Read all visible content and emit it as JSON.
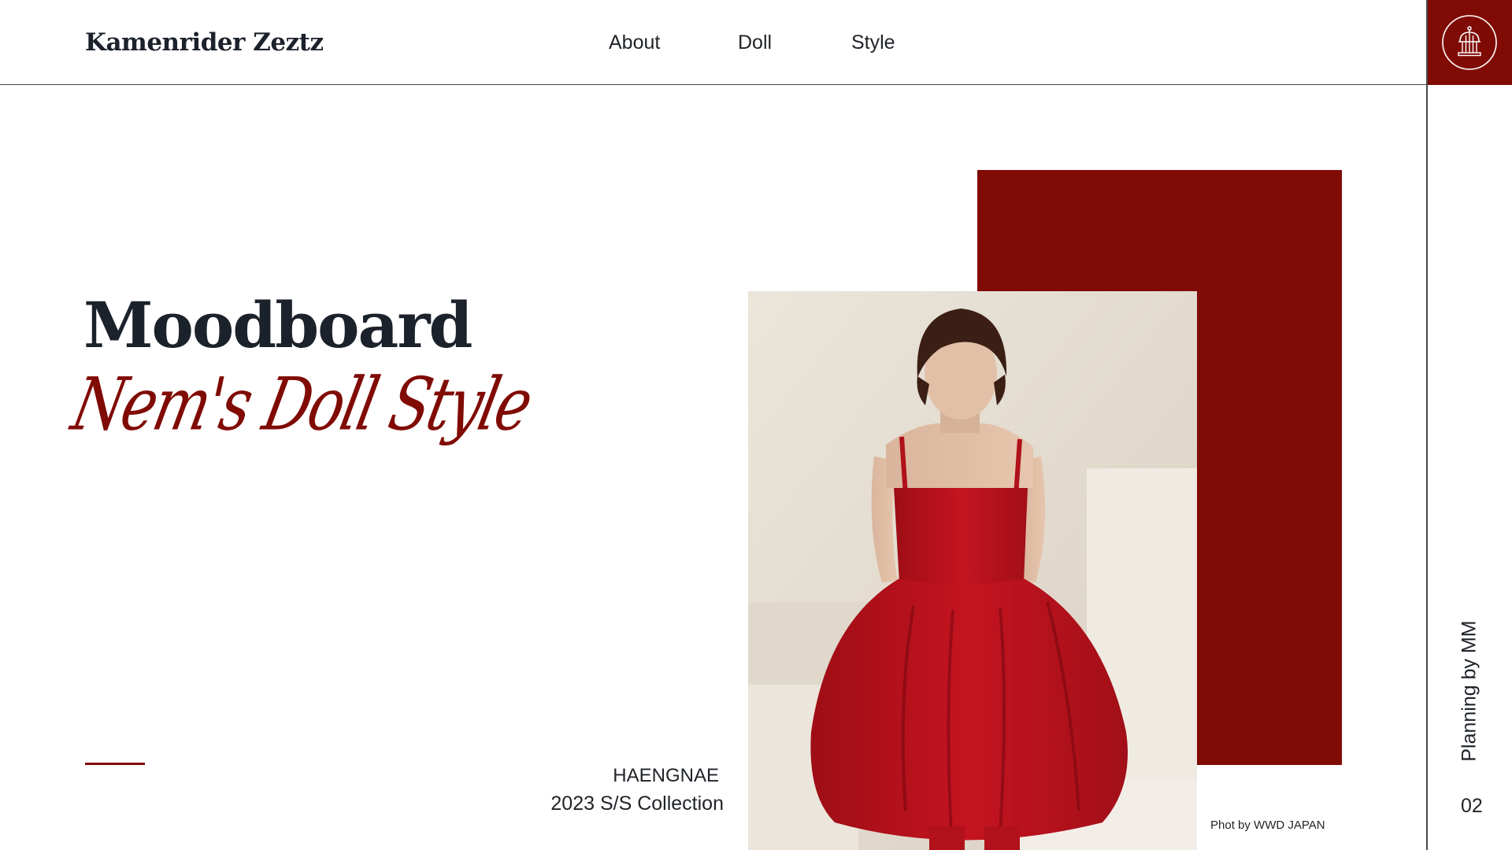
{
  "header": {
    "brand": "Kamenrider Zeztz",
    "nav": [
      {
        "label": "About"
      },
      {
        "label": "Doll"
      },
      {
        "label": "Style"
      }
    ],
    "logo_icon": "birdcage-icon"
  },
  "hero": {
    "title": "Moodboard",
    "script_subtitle": "Nem's Doll Style"
  },
  "collection": {
    "brand": "HAENGNAE",
    "season": "2023 S/S Collection"
  },
  "photo": {
    "credit": "Phot by WWD JAPAN"
  },
  "rail": {
    "credit": "Planning by MM",
    "page_number": "02"
  },
  "colors": {
    "accent": "#800b05",
    "text": "#1c222b",
    "background": "#ffffff"
  }
}
